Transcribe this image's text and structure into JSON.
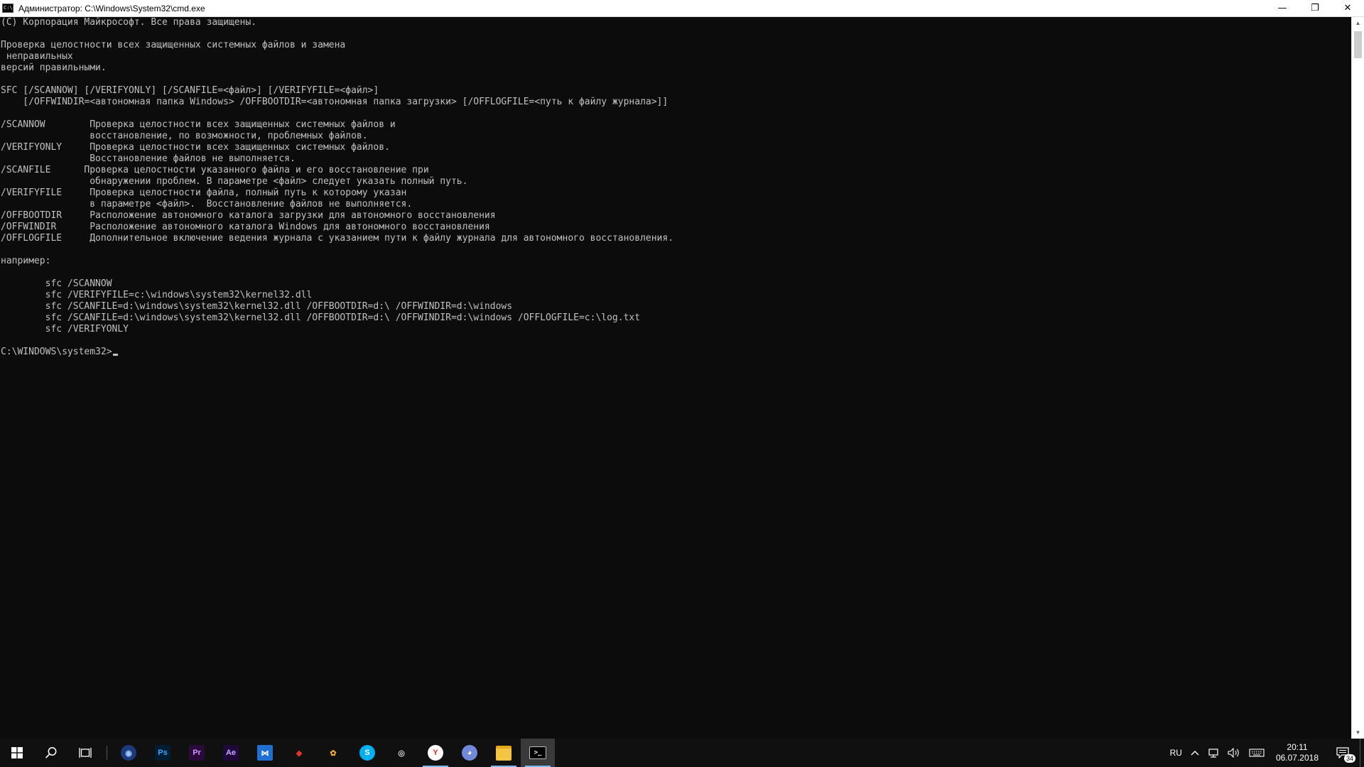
{
  "window": {
    "title": "Администратор: C:\\Windows\\System32\\cmd.exe",
    "app_icon_glyph": "C:\\",
    "minimize": "—",
    "restore": "❐",
    "close": "✕"
  },
  "console": {
    "lines": [
      "(С) Корпорация Майкрософт. Все права защищены.",
      "",
      "Проверка целостности всех защищенных системных файлов и замена",
      " неправильных",
      "версий правильными.",
      "",
      "SFC [/SCANNOW] [/VERIFYONLY] [/SCANFILE=<файл>] [/VERIFYFILE=<файл>]",
      "    [/OFFWINDIR=<автономная папка Windows> /OFFBOOTDIR=<автономная папка загрузки> [/OFFLOGFILE=<путь к файлу журнала>]]",
      "",
      "/SCANNOW        Проверка целостности всех защищенных системных файлов и",
      "                восстановление, по возможности, проблемных файлов.",
      "/VERIFYONLY     Проверка целостности всех защищенных системных файлов.",
      "                Восстановление файлов не выполняется.",
      "/SCANFILE      Проверка целостности указанного файла и его восстановление при",
      "                обнаружении проблем. В параметре <файл> следует указать полный путь.",
      "/VERIFYFILE     Проверка целостности файла, полный путь к которому указан",
      "                в параметре <файл>.  Восстановление файлов не выполняется.",
      "/OFFBOOTDIR     Расположение автономного каталога загрузки для автономного восстановления",
      "/OFFWINDIR      Расположение автономного каталога Windows для автономного восстановления",
      "/OFFLOGFILE     Дополнительное включение ведения журнала с указанием пути к файлу журнала для автономного восстановления.",
      "",
      "например:",
      "",
      "        sfc /SCANNOW",
      "        sfc /VERIFYFILE=c:\\windows\\system32\\kernel32.dll",
      "        sfc /SCANFILE=d:\\windows\\system32\\kernel32.dll /OFFBOOTDIR=d:\\ /OFFWINDIR=d:\\windows",
      "        sfc /SCANFILE=d:\\windows\\system32\\kernel32.dll /OFFBOOTDIR=d:\\ /OFFWINDIR=d:\\windows /OFFLOGFILE=c:\\log.txt",
      "        sfc /VERIFYONLY",
      ""
    ],
    "prompt": "C:\\WINDOWS\\system32>"
  },
  "scrollbar": {
    "up": "▲",
    "down": "▼"
  },
  "taskbar": {
    "start_icon": "windows-logo",
    "apps": [
      {
        "name": "cinema4d-icon",
        "label": "",
        "color": "#1a3a7a",
        "fg": "#9ec3ff",
        "glyph": "◉"
      },
      {
        "name": "photoshop-icon",
        "label": "Ps",
        "color": "#001d34",
        "fg": "#31a8ff"
      },
      {
        "name": "premiere-icon",
        "label": "Pr",
        "color": "#2a0a3a",
        "fg": "#d291ff"
      },
      {
        "name": "after-effects-icon",
        "label": "Ae",
        "color": "#1d0a3a",
        "fg": "#c7a6ff"
      },
      {
        "name": "visual-studio-icon",
        "label": "⋈",
        "color": "#1f6fd1",
        "fg": "#ffffff"
      },
      {
        "name": "git-icon",
        "label": "◆",
        "color": "#101010",
        "fg": "#e0362c"
      },
      {
        "name": "fl-studio-icon",
        "label": "✿",
        "color": "#101010",
        "fg": "#f2a93b"
      },
      {
        "name": "skype-icon",
        "label": "S",
        "color": "#00aff0",
        "fg": "#ffffff"
      },
      {
        "name": "steam-icon",
        "label": "◎",
        "color": "#101010",
        "fg": "#d0d0d0"
      },
      {
        "name": "yandex-browser-icon",
        "label": "Y",
        "color": "#ffffff",
        "fg": "#e62b1e"
      },
      {
        "name": "discord-icon",
        "label": "◕",
        "color": "#7289da",
        "fg": "#ffffff"
      },
      {
        "name": "file-explorer-icon",
        "label": "",
        "color": "#f4c542",
        "fg": "#f4c542"
      },
      {
        "name": "cmd-icon",
        "label": ">_",
        "color": "#000000",
        "fg": "#ffffff"
      }
    ],
    "tray": {
      "language": "RU",
      "time": "20:11",
      "date": "06.07.2018",
      "notifications": "34"
    }
  }
}
